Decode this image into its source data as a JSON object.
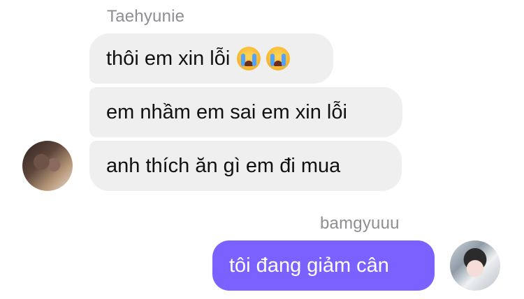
{
  "thread": {
    "incoming": {
      "sender": "Taehyunie",
      "messages": [
        {
          "text": "thôi em xin lỗi",
          "emojis": [
            "loudly-crying-face-emoji",
            "loudly-crying-face-emoji"
          ]
        },
        {
          "text": "em nhầm em sai em xin lỗi"
        },
        {
          "text": "anh thích ăn gì em đi mua"
        }
      ]
    },
    "outgoing": {
      "sender": "bamgyuuu",
      "messages": [
        {
          "text": "tôi đang giảm cân"
        }
      ]
    }
  },
  "colors": {
    "incoming_bubble": "#efefef",
    "outgoing_bubble": "#7b61ff",
    "sender_name": "#8e8e93"
  }
}
